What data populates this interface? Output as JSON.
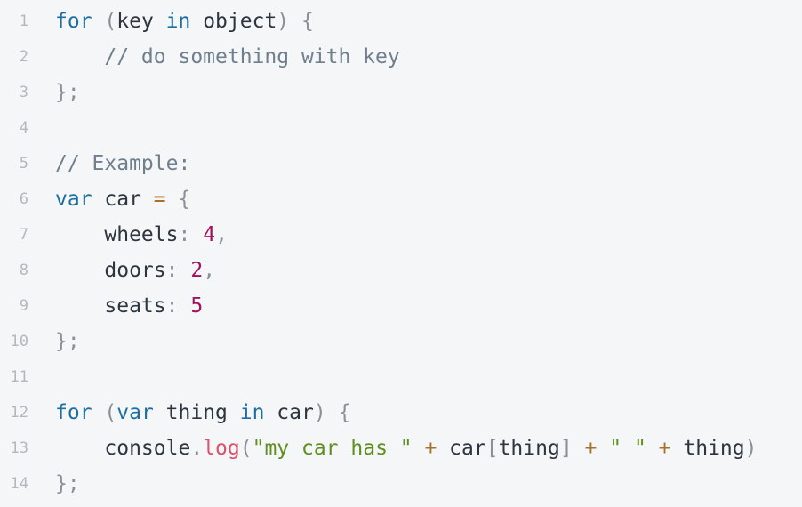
{
  "lines": [
    {
      "number": "1",
      "tokens": [
        {
          "t": "kw",
          "v": "for"
        },
        {
          "t": "id",
          "v": " "
        },
        {
          "t": "pn",
          "v": "("
        },
        {
          "t": "id",
          "v": "key "
        },
        {
          "t": "kw",
          "v": "in"
        },
        {
          "t": "id",
          "v": " object"
        },
        {
          "t": "pn",
          "v": ")"
        },
        {
          "t": "id",
          "v": " "
        },
        {
          "t": "pn",
          "v": "{"
        }
      ]
    },
    {
      "number": "2",
      "tokens": [
        {
          "t": "id",
          "v": "    "
        },
        {
          "t": "cm",
          "v": "// do something with key"
        }
      ]
    },
    {
      "number": "3",
      "tokens": [
        {
          "t": "pn",
          "v": "};"
        }
      ]
    },
    {
      "number": "4",
      "tokens": []
    },
    {
      "number": "5",
      "tokens": [
        {
          "t": "cm",
          "v": "// Example:"
        }
      ]
    },
    {
      "number": "6",
      "tokens": [
        {
          "t": "kw",
          "v": "var"
        },
        {
          "t": "id",
          "v": " car "
        },
        {
          "t": "op",
          "v": "="
        },
        {
          "t": "id",
          "v": " "
        },
        {
          "t": "pn",
          "v": "{"
        }
      ]
    },
    {
      "number": "7",
      "tokens": [
        {
          "t": "id",
          "v": "    wheels"
        },
        {
          "t": "pn",
          "v": ":"
        },
        {
          "t": "id",
          "v": " "
        },
        {
          "t": "nm",
          "v": "4"
        },
        {
          "t": "pn",
          "v": ","
        }
      ]
    },
    {
      "number": "8",
      "tokens": [
        {
          "t": "id",
          "v": "    doors"
        },
        {
          "t": "pn",
          "v": ":"
        },
        {
          "t": "id",
          "v": " "
        },
        {
          "t": "nm",
          "v": "2"
        },
        {
          "t": "pn",
          "v": ","
        }
      ]
    },
    {
      "number": "9",
      "tokens": [
        {
          "t": "id",
          "v": "    seats"
        },
        {
          "t": "pn",
          "v": ":"
        },
        {
          "t": "id",
          "v": " "
        },
        {
          "t": "nm",
          "v": "5"
        }
      ]
    },
    {
      "number": "10",
      "tokens": [
        {
          "t": "pn",
          "v": "};"
        }
      ]
    },
    {
      "number": "11",
      "tokens": []
    },
    {
      "number": "12",
      "tokens": [
        {
          "t": "kw",
          "v": "for"
        },
        {
          "t": "id",
          "v": " "
        },
        {
          "t": "pn",
          "v": "("
        },
        {
          "t": "kw",
          "v": "var"
        },
        {
          "t": "id",
          "v": " thing "
        },
        {
          "t": "kw",
          "v": "in"
        },
        {
          "t": "id",
          "v": " car"
        },
        {
          "t": "pn",
          "v": ")"
        },
        {
          "t": "id",
          "v": " "
        },
        {
          "t": "pn",
          "v": "{"
        }
      ]
    },
    {
      "number": "13",
      "tokens": [
        {
          "t": "id",
          "v": "    console"
        },
        {
          "t": "pn",
          "v": "."
        },
        {
          "t": "fn",
          "v": "log"
        },
        {
          "t": "pn",
          "v": "("
        },
        {
          "t": "st",
          "v": "\"my car has \""
        },
        {
          "t": "id",
          "v": " "
        },
        {
          "t": "op",
          "v": "+"
        },
        {
          "t": "id",
          "v": " car"
        },
        {
          "t": "pn",
          "v": "["
        },
        {
          "t": "id",
          "v": "thing"
        },
        {
          "t": "pn",
          "v": "]"
        },
        {
          "t": "id",
          "v": " "
        },
        {
          "t": "op",
          "v": "+"
        },
        {
          "t": "id",
          "v": " "
        },
        {
          "t": "st",
          "v": "\" \""
        },
        {
          "t": "id",
          "v": " "
        },
        {
          "t": "op",
          "v": "+"
        },
        {
          "t": "id",
          "v": " thing"
        },
        {
          "t": "pn",
          "v": ")"
        }
      ]
    },
    {
      "number": "14",
      "tokens": [
        {
          "t": "pn",
          "v": "};"
        }
      ]
    }
  ],
  "colors": {
    "background": "#f5f6f8",
    "keyword": "#1e6fa0",
    "comment": "#6f7f8e",
    "punctuation": "#8a9097",
    "operator": "#a8702a",
    "number": "#a3105f",
    "string": "#5f8f1e",
    "function": "#d9536a",
    "identifier": "#2c3540",
    "line_number": "#b4b8be"
  }
}
